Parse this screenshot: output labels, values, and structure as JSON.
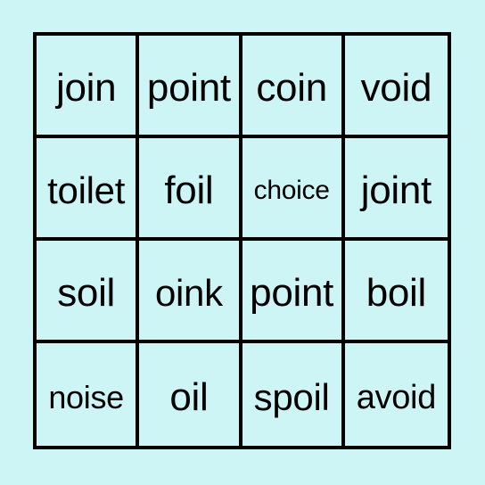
{
  "card": {
    "type": "bingo-card",
    "columns": 4,
    "rows": 4,
    "background_color": "#cdf5f5",
    "cell_color": "#cdf5f5",
    "border_color": "#000000",
    "text_color": "#000000",
    "cells": [
      {
        "text": "join",
        "row": 1,
        "col": 1,
        "size": "size-xl"
      },
      {
        "text": "point",
        "row": 1,
        "col": 2,
        "size": "size-xl"
      },
      {
        "text": "coin",
        "row": 1,
        "col": 3,
        "size": "size-xl"
      },
      {
        "text": "void",
        "row": 1,
        "col": 4,
        "size": "size-xl"
      },
      {
        "text": "toilet",
        "row": 2,
        "col": 1,
        "size": "size-lg"
      },
      {
        "text": "foil",
        "row": 2,
        "col": 2,
        "size": "size-xl"
      },
      {
        "text": "choice",
        "row": 2,
        "col": 3,
        "size": "size-xs"
      },
      {
        "text": "joint",
        "row": 2,
        "col": 4,
        "size": "size-xl"
      },
      {
        "text": "soil",
        "row": 3,
        "col": 1,
        "size": "size-xl"
      },
      {
        "text": "oink",
        "row": 3,
        "col": 2,
        "size": "size-lg"
      },
      {
        "text": "point",
        "row": 3,
        "col": 3,
        "size": "size-xl"
      },
      {
        "text": "boil",
        "row": 3,
        "col": 4,
        "size": "size-xl"
      },
      {
        "text": "noise",
        "row": 4,
        "col": 1,
        "size": "size-sm"
      },
      {
        "text": "oil",
        "row": 4,
        "col": 2,
        "size": "size-xl"
      },
      {
        "text": "spoil",
        "row": 4,
        "col": 3,
        "size": "size-lg"
      },
      {
        "text": "avoid",
        "row": 4,
        "col": 4,
        "size": "size-md"
      }
    ]
  }
}
